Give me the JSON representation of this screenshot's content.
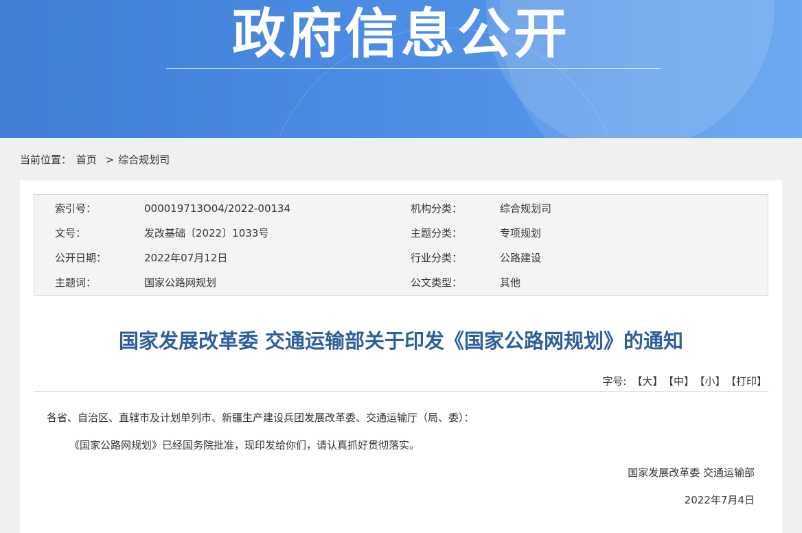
{
  "banner": {
    "title": "政府信息公开"
  },
  "breadcrumb": {
    "prefix": "当前位置：",
    "home": "首页",
    "separator": ">",
    "current": "综合规划司"
  },
  "meta": {
    "index_label": "索引号：",
    "index_value": "000019713O04/2022-00134",
    "org_label": "机构分类：",
    "org_value": "综合规划司",
    "docno_label": "文号：",
    "docno_value": "发改基础〔2022〕1033号",
    "topic_label": "主题分类：",
    "topic_value": "专项规划",
    "date_label": "公开日期：",
    "date_value": "2022年07月12日",
    "industry_label": "行业分类：",
    "industry_value": "公路建设",
    "keyword_label": "主题词：",
    "keyword_value": "国家公路网规划",
    "type_label": "公文类型：",
    "type_value": "其他"
  },
  "document": {
    "title": "国家发展改革委 交通运输部关于印发《国家公路网规划》的通知",
    "font_label": "字号:",
    "font_large": "【大】",
    "font_medium": "【中】",
    "font_small": "【小】",
    "print": "【打印】",
    "salutation": "各省、自治区、直辖市及计划单列市、新疆生产建设兵团发展改革委、交通运输厅（局、委）：",
    "body": "《国家公路网规划》已经国务院批准，现印发给你们，请认真抓好贯彻落实。",
    "signature": "国家发展改革委 交通运输部",
    "date": "2022年7月4日"
  },
  "colors": {
    "banner": "#4a8be3",
    "title": "#2c5f9c",
    "meta_bg": "#f4f4f4"
  }
}
